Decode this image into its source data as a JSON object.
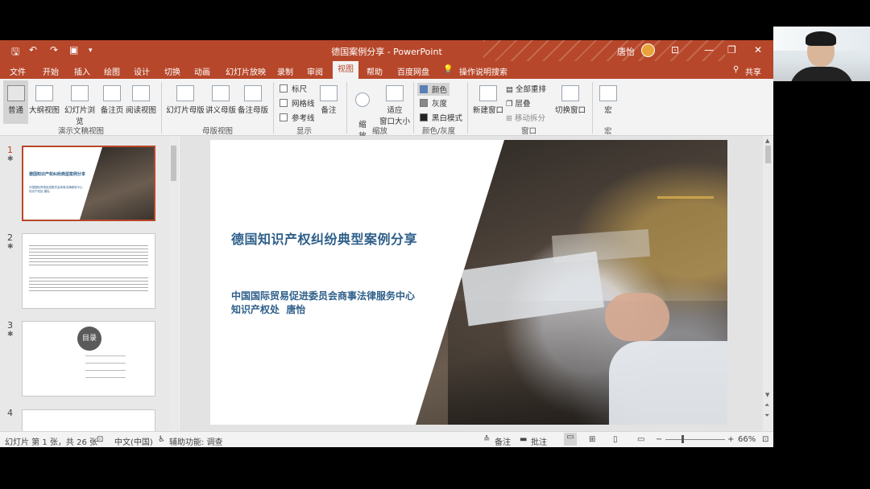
{
  "window": {
    "title": "德国案例分享 - PowerPoint",
    "user": "唐怡",
    "share_label": "共享"
  },
  "colors": {
    "accent": "#b7472a",
    "slide_title": "#2e5f8a"
  },
  "quick_access": [
    "save-icon",
    "undo-icon",
    "redo-icon",
    "present-icon",
    "customize-icon"
  ],
  "tabs": [
    "文件",
    "开始",
    "插入",
    "绘图",
    "设计",
    "切换",
    "动画",
    "幻灯片放映",
    "录制",
    "审阅",
    "视图",
    "帮助",
    "百度网盘",
    "操作说明搜索"
  ],
  "active_tab": "视图",
  "ribbon": {
    "presentation_views": {
      "group_label": "演示文稿视图",
      "items": [
        "普通",
        "大纲视图",
        "幻灯片浏览",
        "备注页",
        "阅读视图"
      ]
    },
    "master_views": {
      "group_label": "母版视图",
      "items": [
        "幻灯片母版",
        "讲义母版",
        "备注母版"
      ]
    },
    "show": {
      "group_label": "显示",
      "checks": [
        "标尺",
        "网格线",
        "参考线"
      ],
      "notes": "备注"
    },
    "zoom": {
      "group_label": "缩放",
      "zoom_label": "缩\n放",
      "fit_label_1": "适应",
      "fit_label_2": "窗口大小"
    },
    "color": {
      "group_label": "颜色/灰度",
      "items": [
        "颜色",
        "灰度",
        "黑白模式"
      ]
    },
    "window": {
      "group_label": "窗口",
      "new_window": "新建窗口",
      "arrange_all": "全部重排",
      "cascade": "层叠",
      "move_split": "移动拆分",
      "switch": "切换窗口"
    },
    "macros": {
      "group_label": "宏",
      "label": "宏"
    }
  },
  "slides_panel": {
    "thumbs": [
      {
        "num": "1",
        "title": "德国知识产权纠纷典型案例分享",
        "sub": "中国国际贸易促进委员会商事法律服务中心 知识产权处 唐怡"
      },
      {
        "num": "2"
      },
      {
        "num": "3",
        "heading": "目录"
      },
      {
        "num": "4"
      }
    ]
  },
  "slide": {
    "title": "德国知识产权纠纷典型案例分享",
    "subtitle_line1": "中国国际贸易促进委员会商事法律服务中心",
    "subtitle_line2": "知识产权处  唐怡"
  },
  "status": {
    "slide_counter": "幻灯片 第 1 张，共 26 张",
    "language": "中文(中国)",
    "accessibility": "辅助功能: 调查",
    "notes": "备注",
    "comments": "批注",
    "zoom": "66%"
  }
}
